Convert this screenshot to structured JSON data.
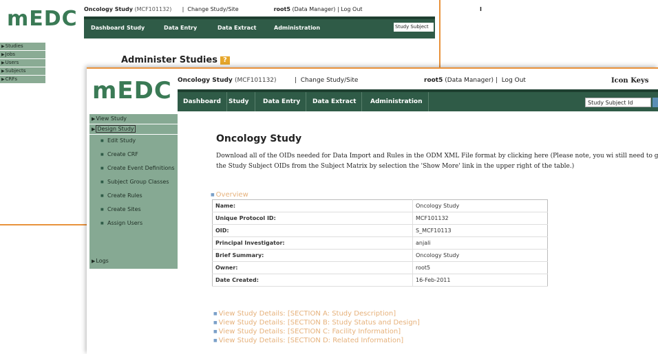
{
  "back_window": {
    "logo": "mEDC",
    "study_name": "Oncology Study",
    "study_code": "(MCF101132)",
    "change_link": "Change Study/Site",
    "user": "root5",
    "role": "(Data Manager)",
    "logout": "Log Out",
    "corner_text": "I",
    "nav": [
      "Dashboard",
      "Study",
      "Data Entry",
      "Data Extract",
      "Administration"
    ],
    "search_label": "Study Subject",
    "sidebar": [
      "Studies",
      "Jobs",
      "Users",
      "Subjects",
      "CRFs"
    ],
    "page_title": "Administer Studies",
    "help_icon": "?"
  },
  "front_window": {
    "logo": "mEDC",
    "study_name": "Oncology Study",
    "study_code": "(MCF101132)",
    "change_link": "Change Study/Site",
    "user": "root5",
    "role": "(Data Manager)",
    "logout": "Log Out",
    "icon_keys": "Icon Keys",
    "nav": [
      "Dashboard",
      "Study",
      "Data Entry",
      "Data Extract",
      "Administration"
    ],
    "search_placeholder": "Study Subject Id",
    "sidebar": {
      "view_study": "View Study",
      "design_study": "Design Study",
      "design_items": [
        "Edit Study",
        "Create CRF",
        "Create Event Definitions",
        "Subject Group Classes",
        "Create Rules",
        "Create Sites",
        "Assign Users"
      ],
      "logs": "Logs"
    },
    "page_title": "Oncology Study",
    "intro": "Download all of the OIDs needed for Data Import and Rules in the ODM XML File format by clicking here (Please note, you wi still need to get the Study Subject OIDs from the Subject Matrix by selection the 'Show More' link in the upper right of the table.)",
    "overview_label": "Overview",
    "overview": [
      {
        "key": "Name:",
        "value": "Oncology Study"
      },
      {
        "key": "Unique Protocol ID:",
        "value": "MCF101132"
      },
      {
        "key": "OID:",
        "value": "S_MCF10113"
      },
      {
        "key": "Principal Investigator:",
        "value": "anjali"
      },
      {
        "key": "Brief Summary:",
        "value": "Oncology Study"
      },
      {
        "key": "Owner:",
        "value": "root5"
      },
      {
        "key": "Date Created:",
        "value": "16-Feb-2011"
      }
    ],
    "sections": [
      "View Study Details: [SECTION A: Study Description]",
      "View Study Details: [SECTION B: Study Status and Design]",
      "View Study Details: [SECTION C: Facility Information]",
      "View Study Details: [SECTION D: Related Information]"
    ]
  },
  "colors": {
    "nav_bg": "#2f5b47",
    "sidebar_bg": "#86a993",
    "accent_orange": "#e8913a",
    "link_orange": "#e6b17b"
  }
}
